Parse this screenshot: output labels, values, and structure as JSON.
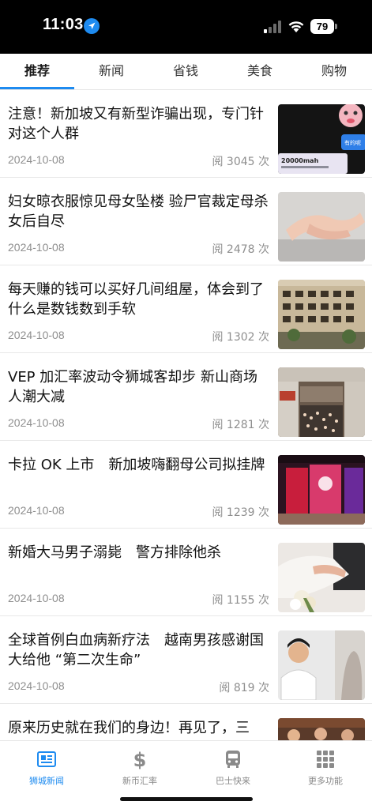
{
  "status_bar": {
    "time": "11:03",
    "battery": "79",
    "icons": [
      "location-arrow-icon",
      "cellular-signal-icon",
      "wifi-icon",
      "battery-icon"
    ]
  },
  "tabs": [
    {
      "label": "推荐",
      "active": true
    },
    {
      "label": "新闻",
      "active": false
    },
    {
      "label": "省钱",
      "active": false
    },
    {
      "label": "美食",
      "active": false
    },
    {
      "label": "购物",
      "active": false
    }
  ],
  "articles": [
    {
      "title": "注意！新加坡又有新型诈骗出现，专门针对这个人群",
      "date": "2024-10-08",
      "views": "阅 3045 次",
      "thumb_text": [
        "有的呢",
        "20000mah"
      ]
    },
    {
      "title": "妇女晾衣服惊见母女坠楼 验尸官裁定母杀女后自尽",
      "date": "2024-10-08",
      "views": "阅 2478 次"
    },
    {
      "title": "每天赚的钱可以买好几间组屋，体会到了什么是数钱数到手软",
      "date": "2024-10-08",
      "views": "阅 1302 次"
    },
    {
      "title": "VEP 加汇率波动令狮城客却步 新山商场人潮大减",
      "date": "2024-10-08",
      "views": "阅 1281 次"
    },
    {
      "title": "卡拉 OK 上市　新加坡嗨翻母公司拟挂牌",
      "date": "2024-10-08",
      "views": "阅 1239 次"
    },
    {
      "title": "新婚大马男子溺毙　警方排除他杀",
      "date": "2024-10-08",
      "views": "阅 1155 次"
    },
    {
      "title": "全球首例白血病新疗法　越南男孩感谢国大给他 “第二次生命”",
      "date": "2024-10-08",
      "views": "阅 819 次"
    },
    {
      "title": "原来历史就在我们的身边！再见了，三",
      "date": "",
      "views": ""
    }
  ],
  "bottom_nav": [
    {
      "label": "狮城新闻",
      "icon": "newspaper-icon",
      "active": true
    },
    {
      "label": "新币汇率",
      "icon": "dollar-icon",
      "active": false
    },
    {
      "label": "巴士快来",
      "icon": "bus-icon",
      "active": false
    },
    {
      "label": "更多功能",
      "icon": "grid-icon",
      "active": false
    }
  ],
  "colors": {
    "accent": "#1e8bf0",
    "meta_text": "#8e8e8e",
    "title_text": "#111111"
  }
}
